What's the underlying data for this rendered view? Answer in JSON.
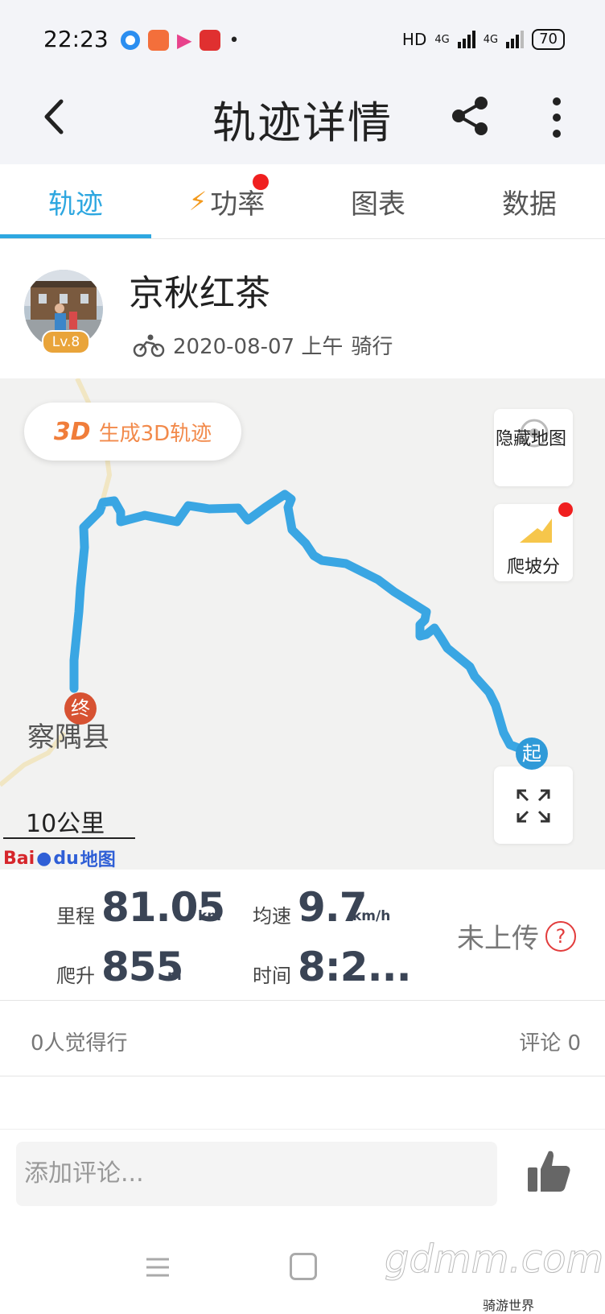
{
  "status_bar": {
    "time": "22:23",
    "hd": "HD",
    "net1": "4G",
    "net2": "4G",
    "battery": "70"
  },
  "header": {
    "title": "轨迹详情"
  },
  "tabs": [
    {
      "label": "轨迹",
      "active": true
    },
    {
      "label": "功率",
      "icon": "lightning-icon",
      "has_dot": true
    },
    {
      "label": "图表"
    },
    {
      "label": "数据"
    }
  ],
  "profile": {
    "name": "京秋红茶",
    "level": "Lv.8",
    "date": "2020-08-07 上午",
    "activity": "骑行"
  },
  "map": {
    "btn_3d_badge": "3D",
    "btn_3d_label": "生成3D轨迹",
    "hide_map_label": "隐藏地图",
    "climb_label": "爬坡分",
    "town_label": "察隅县",
    "scale_label": "10公里",
    "end_marker": "终",
    "start_marker": "起",
    "logo_text": "Bai",
    "logo_text2": "du",
    "logo_text3": "地图",
    "route_color": "#3aa6e3"
  },
  "stats": {
    "distance": {
      "label": "里程",
      "value": "81.05",
      "unit": "km"
    },
    "avg_speed": {
      "label": "均速",
      "value": "9.7",
      "unit": "km/h"
    },
    "climb": {
      "label": "爬升",
      "value": "855",
      "unit": "m"
    },
    "time": {
      "label": "时间",
      "value": "8:2..."
    },
    "upload_status": "未上传",
    "help_symbol": "?"
  },
  "social": {
    "likes": "0人觉得行",
    "comments": "评论 0"
  },
  "comment_input": {
    "placeholder": "添加评论..."
  },
  "watermark": {
    "site": "gdmm.com",
    "account": "骑游世界"
  }
}
